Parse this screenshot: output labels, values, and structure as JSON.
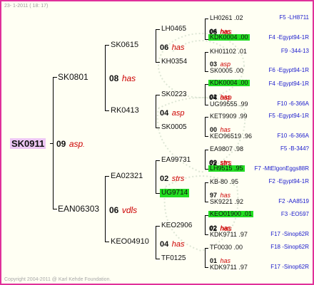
{
  "header": {
    "text": "23- 1-2011 ( 18: 17)"
  },
  "footer": {
    "text": "Copyright 2004-2011 @ Karl Kehde Foundation."
  },
  "colors": {
    "border": "#e0309a",
    "highlight": "#22dd22",
    "root_bg": "#eec8f5",
    "info": "#1a1acc",
    "bee_type": "#cc0000"
  },
  "root": {
    "id": "SK0911",
    "year": "09",
    "type": "asp",
    "type_suffix": "."
  },
  "gen1": [
    {
      "id": "SK0801",
      "year": "08",
      "type": "has"
    },
    {
      "id": "EAN06303",
      "year": "06",
      "type": "vdls"
    }
  ],
  "gen2": [
    {
      "id": "SK0615",
      "year": "06",
      "type": "has"
    },
    {
      "id": "RK0413",
      "year": "04",
      "type": "asp"
    },
    {
      "id": "EA02321",
      "year": "02",
      "type": "strs"
    },
    {
      "id": "KEO04910",
      "year": "04",
      "type": "has"
    }
  ],
  "gen3": [
    {
      "id": "LH0465",
      "year": "06",
      "type": "has"
    },
    {
      "id": "KH0354",
      "year": "",
      "type": ""
    },
    {
      "id": "SK0223",
      "year": "04",
      "type": "asp"
    },
    {
      "id": "SK0005",
      "year": "",
      "type": ""
    },
    {
      "id": "EA99731",
      "year": "02",
      "type": "strs"
    },
    {
      "id": "UG9714",
      "year": "",
      "type": ""
    },
    {
      "id": "KEO2906",
      "year": "02",
      "type": "has"
    },
    {
      "id": "TF0125",
      "year": "",
      "type": ""
    }
  ],
  "gen4": [
    {
      "id": "LH0261 .02",
      "year": "04",
      "type": "has",
      "mother": "KDK0004 .00",
      "info": "F5 -LH8711"
    },
    {
      "id": "",
      "year": "",
      "type": "",
      "mother": "",
      "info": "F4 -Egypt94-1R"
    },
    {
      "id": "KH01102 .01",
      "year": "03",
      "type": "asp",
      "mother": "SK0005 .00",
      "info": "F9 -344-13"
    },
    {
      "id": "",
      "year": "",
      "type": "",
      "mother": "",
      "info": "F6 -Egypt94-1R"
    },
    {
      "id": "KDK0004 .00",
      "year": "02",
      "type": "has",
      "mother": "UG99555 .99",
      "info": "F4 -Egypt94-1R"
    },
    {
      "id": "",
      "year": "",
      "type": "",
      "mother": "",
      "info": "F10 -6-366A"
    },
    {
      "id": "KET9909 .99",
      "year": "00",
      "type": "has",
      "mother": "KEO96519 .96",
      "info": "F5 -Egypt94-1R"
    },
    {
      "id": "",
      "year": "",
      "type": "",
      "mother": "",
      "info": "F10 -6-366A"
    },
    {
      "id": "EA9807 .98",
      "year": "99",
      "type": "strs",
      "mother": "LH9515 .95",
      "info": "F5 -B-344?"
    },
    {
      "id": "",
      "year": "",
      "type": "",
      "mother": "",
      "info": "F7 -MtElgonEggs88R"
    },
    {
      "id": "KB-80 .95",
      "year": "97",
      "type": "has",
      "mother": "SK9221 .92",
      "info": "F2 -Egypt94-1R"
    },
    {
      "id": "",
      "year": "",
      "type": "",
      "mother": "",
      "info": "F2 -AA8519"
    },
    {
      "id": "KEO01900 .01",
      "year": "02",
      "type": "has",
      "mother": "KDK9711 .97",
      "info": "F3 -EO597"
    },
    {
      "id": "",
      "year": "",
      "type": "",
      "mother": "",
      "info": "F17 -Sinop62R"
    },
    {
      "id": "TF0030 .00",
      "year": "01",
      "type": "has",
      "mother": "KDK9711 .97",
      "info": "F18 -Sinop62R"
    },
    {
      "id": "",
      "year": "",
      "type": "",
      "mother": "",
      "info": "F17 -Sinop62R"
    }
  ]
}
